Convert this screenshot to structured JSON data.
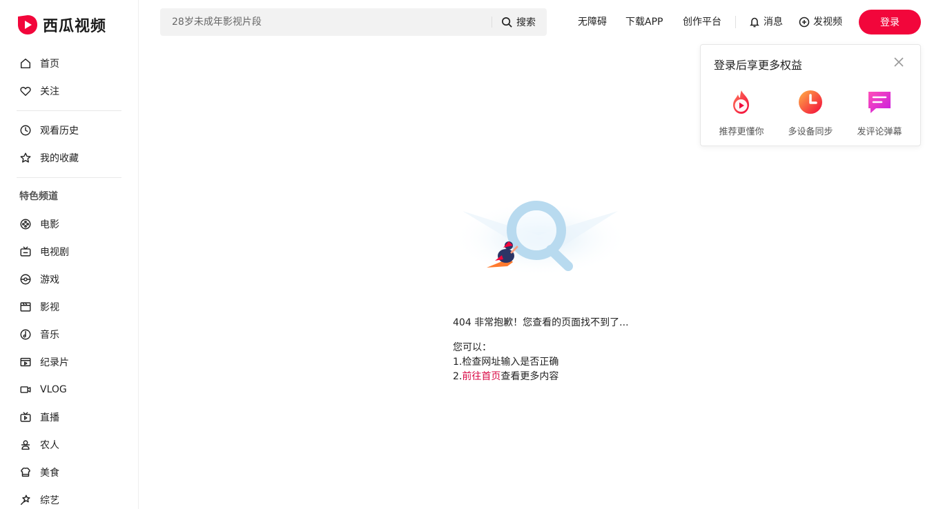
{
  "brand": {
    "name": "西瓜视频",
    "accent": "#f2063b"
  },
  "sidebar": {
    "main_items": [
      {
        "label": "首页",
        "icon": "home-icon"
      },
      {
        "label": "关注",
        "icon": "heart-icon"
      }
    ],
    "personal_items": [
      {
        "label": "观看历史",
        "icon": "history-icon"
      },
      {
        "label": "我的收藏",
        "icon": "star-icon"
      }
    ],
    "section_title": "特色频道",
    "channels": [
      {
        "label": "电影",
        "icon": "film-reel-icon"
      },
      {
        "label": "电视剧",
        "icon": "tv-icon"
      },
      {
        "label": "游戏",
        "icon": "gamepad-icon"
      },
      {
        "label": "影视",
        "icon": "clapperboard-icon"
      },
      {
        "label": "音乐",
        "icon": "music-icon"
      },
      {
        "label": "纪录片",
        "icon": "documentary-icon"
      },
      {
        "label": "VLOG",
        "icon": "camera-icon"
      },
      {
        "label": "直播",
        "icon": "live-icon"
      },
      {
        "label": "农人",
        "icon": "farmer-icon"
      },
      {
        "label": "美食",
        "icon": "food-icon"
      },
      {
        "label": "综艺",
        "icon": "variety-icon"
      }
    ]
  },
  "header": {
    "search_placeholder": "28岁未成年影视片段",
    "search_button": "搜索",
    "links": [
      "无障碍",
      "下载APP",
      "创作平台"
    ],
    "messages": "消息",
    "upload": "发视频",
    "login": "登录"
  },
  "popup": {
    "title": "登录后享更多权益",
    "benefits": [
      {
        "label": "推荐更懂你",
        "icon": "flame-play-icon"
      },
      {
        "label": "多设备同步",
        "icon": "clock-sync-icon"
      },
      {
        "label": "发评论弹幕",
        "icon": "comment-icon"
      }
    ]
  },
  "error": {
    "title": "404 非常抱歉！您查看的页面找不到了...",
    "intro": "您可以：",
    "item1": "1.检查网址输入是否正确",
    "item2_prefix": "2.",
    "item2_link": "前往首页",
    "item2_suffix": "查看更多内容"
  }
}
